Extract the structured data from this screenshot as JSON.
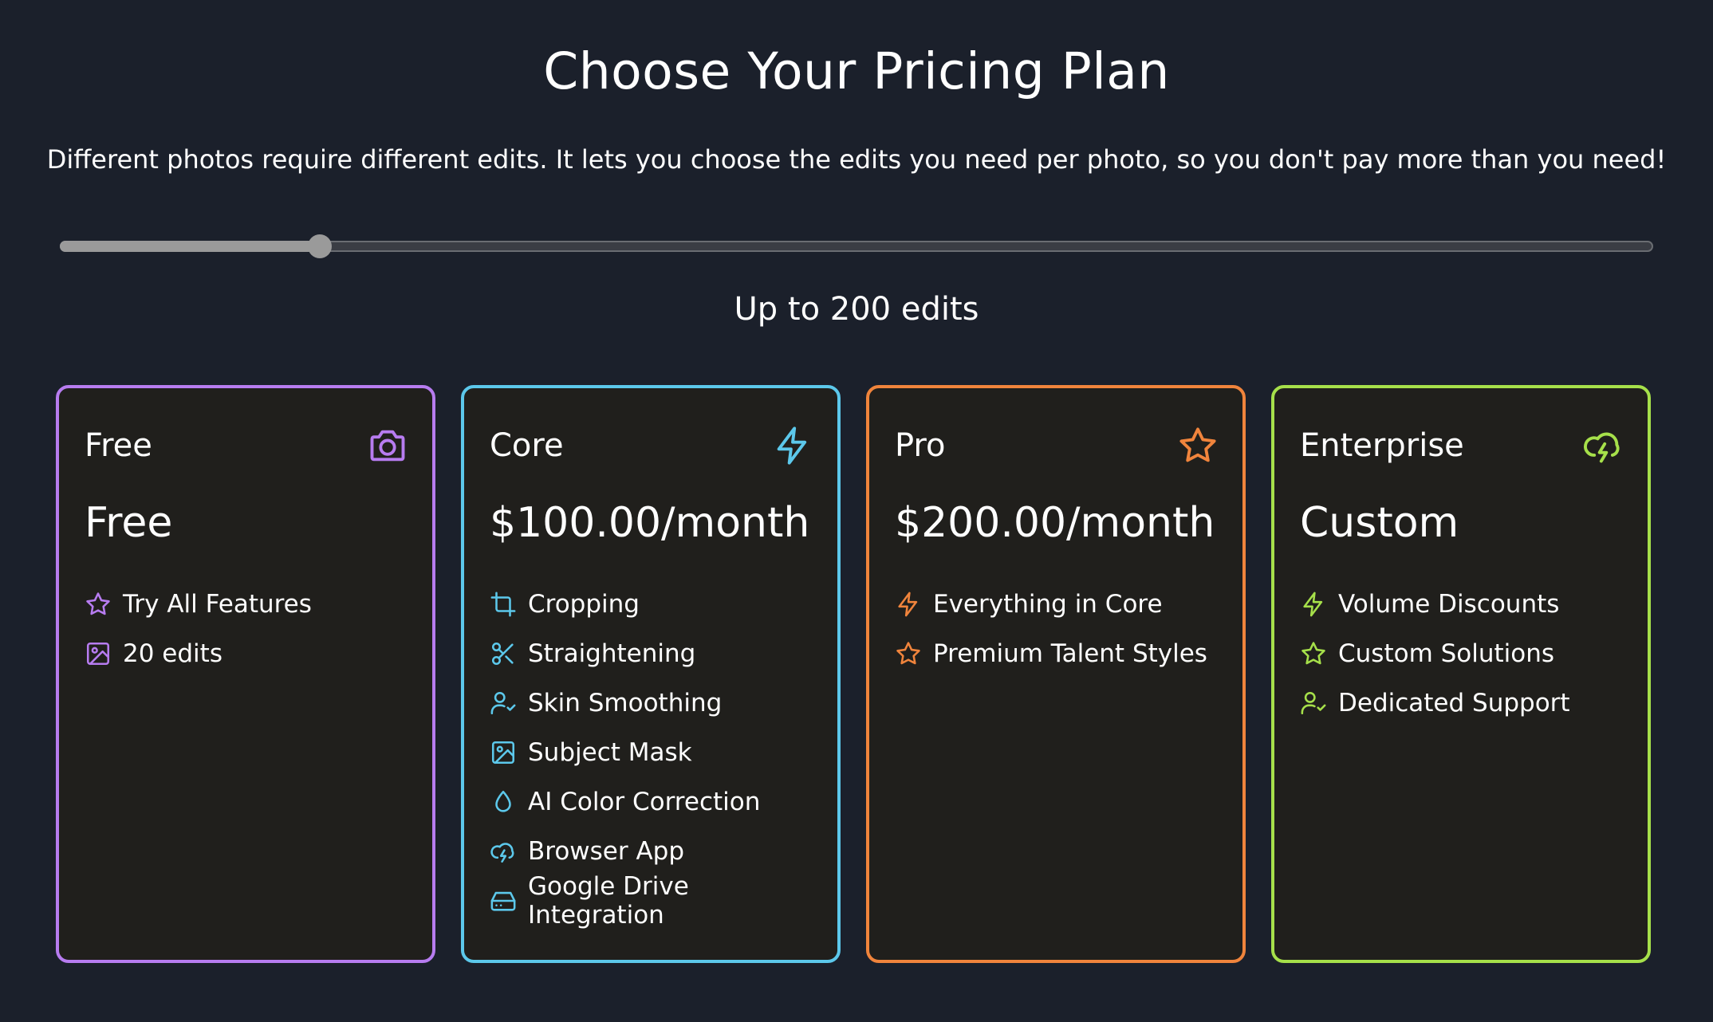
{
  "header": {
    "title": "Choose Your Pricing Plan",
    "subtitle": "Different photos require different edits. It lets you choose the edits you need per photo, so you don't pay more than you need!"
  },
  "slider": {
    "value_fraction": 0.163,
    "label": "Up to 200 edits"
  },
  "plans": [
    {
      "name": "Free",
      "price": "Free",
      "color": "#b77cf0",
      "icon": "camera-icon",
      "features": [
        {
          "label": "Try All Features",
          "icon": "star-icon"
        },
        {
          "label": "20 edits",
          "icon": "image-icon"
        }
      ]
    },
    {
      "name": "Core",
      "price": "$100.00/month",
      "color": "#5cc8eb",
      "icon": "lightning-icon",
      "features": [
        {
          "label": "Cropping",
          "icon": "crop-icon"
        },
        {
          "label": "Straightening",
          "icon": "scissors-icon"
        },
        {
          "label": "Skin Smoothing",
          "icon": "user-check-icon"
        },
        {
          "label": "Subject Mask",
          "icon": "image-icon"
        },
        {
          "label": "AI Color Correction",
          "icon": "droplet-icon"
        },
        {
          "label": "Browser App",
          "icon": "cloud-lightning-icon"
        },
        {
          "label": "Google Drive Integration",
          "icon": "hard-drive-icon"
        }
      ]
    },
    {
      "name": "Pro",
      "price": "$200.00/month",
      "color": "#f0843c",
      "icon": "star-icon",
      "features": [
        {
          "label": "Everything in Core",
          "icon": "lightning-icon"
        },
        {
          "label": "Premium Talent Styles",
          "icon": "star-icon"
        }
      ]
    },
    {
      "name": "Enterprise",
      "price": "Custom",
      "color": "#a6e04a",
      "icon": "cloud-lightning-icon",
      "features": [
        {
          "label": "Volume Discounts",
          "icon": "lightning-icon"
        },
        {
          "label": "Custom Solutions",
          "icon": "star-icon"
        },
        {
          "label": "Dedicated Support",
          "icon": "user-check-icon"
        }
      ]
    }
  ]
}
